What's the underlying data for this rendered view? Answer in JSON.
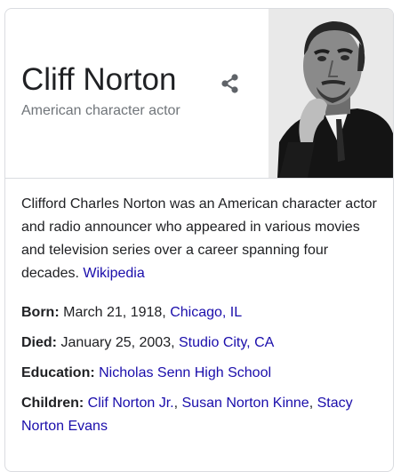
{
  "entity": {
    "name": "Cliff Norton",
    "subtitle": "American character actor"
  },
  "share_icon": "share-icon",
  "photo_icon": "portrait-photo",
  "description": {
    "text": "Clifford Charles Norton was an American character actor and radio announcer who appeared in various movies and television series over a career spanning four decades.",
    "source_link": "Wikipedia"
  },
  "facts": {
    "born": {
      "label": "Born:",
      "value": "March 21, 1918,",
      "link": "Chicago, IL"
    },
    "died": {
      "label": "Died:",
      "value": "January 25, 2003,",
      "link": "Studio City, CA"
    },
    "education": {
      "label": "Education:",
      "link": "Nicholas Senn High School"
    },
    "children": {
      "label": "Children:",
      "links": [
        "Clif Norton Jr.",
        "Susan Norton Kinne",
        "Stacy Norton Evans"
      ],
      "separator": ","
    }
  },
  "colors": {
    "link": "#1a0dab",
    "text": "#202124",
    "muted": "#70757a",
    "border": "#dadce0"
  }
}
